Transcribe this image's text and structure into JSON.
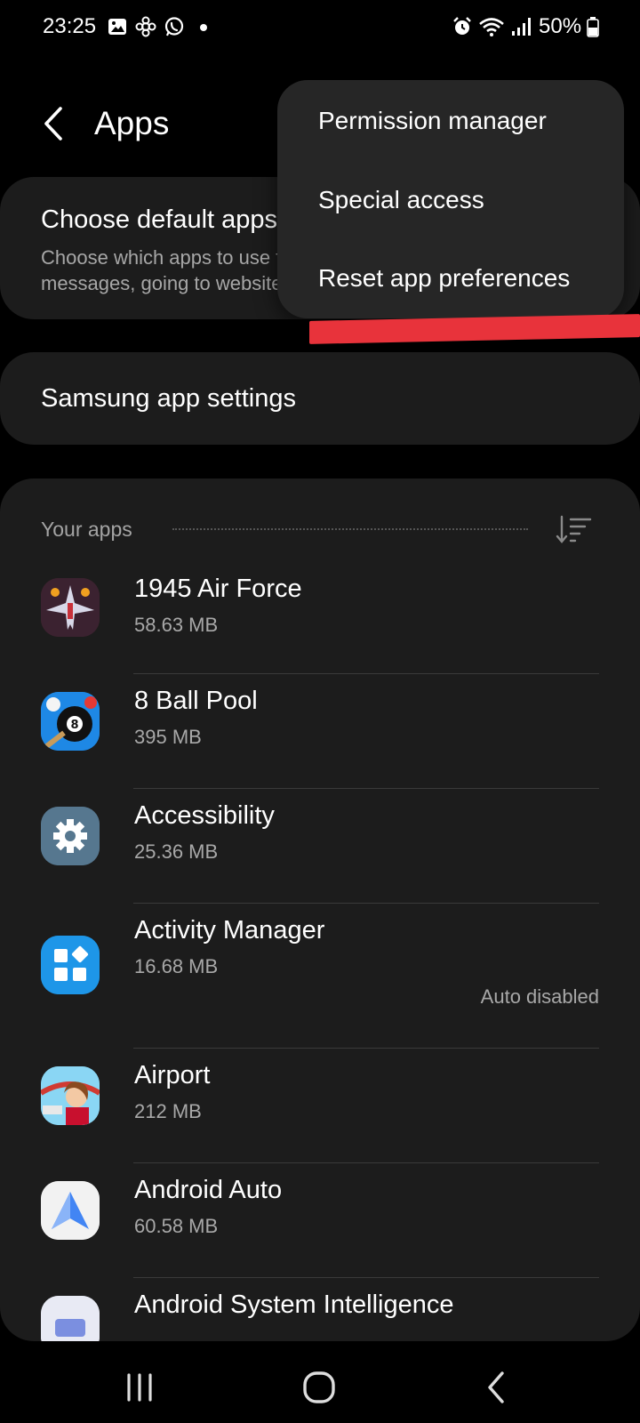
{
  "status_bar": {
    "time": "23:25",
    "battery": "50%",
    "left_icons": [
      "gallery-icon",
      "flower-icon",
      "whatsapp-icon",
      "notification-dot"
    ],
    "right_icons": [
      "alarm-icon",
      "wifi-icon",
      "signal-icon",
      "battery-icon"
    ]
  },
  "header": {
    "title": "Apps"
  },
  "default_apps_card": {
    "title": "Choose default apps",
    "subtitle_line1": "Choose which apps to use for making calls, sending",
    "subtitle_line2": "messages, going to websites, and more."
  },
  "samsung_card": {
    "title": "Samsung app settings"
  },
  "apps_section": {
    "header": "Your apps",
    "apps": [
      {
        "name": "1945 Air Force",
        "size": "58.63 MB",
        "status": "",
        "icon": "airforce-game-icon"
      },
      {
        "name": "8 Ball Pool",
        "size": "395 MB",
        "status": "",
        "icon": "pool-ball-icon"
      },
      {
        "name": "Accessibility",
        "size": "25.36 MB",
        "status": "",
        "icon": "gear-icon"
      },
      {
        "name": "Activity Manager",
        "size": "16.68 MB",
        "status": "Auto disabled",
        "icon": "widgets-icon"
      },
      {
        "name": "Airport",
        "size": "212 MB",
        "status": "",
        "icon": "airport-game-icon"
      },
      {
        "name": "Android Auto",
        "size": "60.58 MB",
        "status": "",
        "icon": "android-auto-icon"
      },
      {
        "name": "Android System Intelligence",
        "size": "",
        "status": "",
        "icon": "system-intelligence-icon"
      }
    ]
  },
  "menu": {
    "items": [
      "Permission manager",
      "Special access",
      "Reset app preferences"
    ]
  },
  "colors": {
    "background": "#000000",
    "card": "#1c1c1c",
    "menu": "#262626",
    "annotation": "#e8333b",
    "accent_blue": "#1e96e8"
  }
}
